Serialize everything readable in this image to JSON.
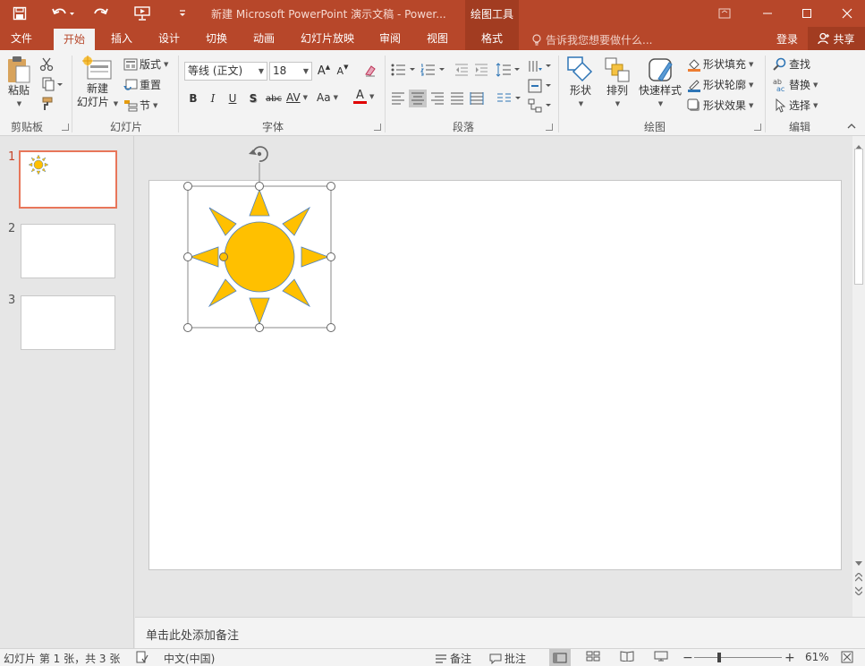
{
  "window": {
    "title": "新建 Microsoft PowerPoint 演示文稿 - Power...",
    "drawing_tools": "绘图工具"
  },
  "tabs": [
    "文件",
    "开始",
    "插入",
    "设计",
    "切换",
    "动画",
    "幻灯片放映",
    "审阅",
    "视图",
    "格式"
  ],
  "active_tab": "开始",
  "tell_me": "告诉我您想要做什么...",
  "account": {
    "login": "登录",
    "share": "共享"
  },
  "ribbon": {
    "clipboard": {
      "paste": "粘贴",
      "label": "剪贴板"
    },
    "slides": {
      "new_slide_line1": "新建",
      "new_slide_line2": "幻灯片",
      "layout": "版式",
      "reset": "重置",
      "section": "节",
      "label": "幻灯片"
    },
    "font": {
      "font_name": "等线 (正文)",
      "font_size": "18",
      "bold": "B",
      "italic": "I",
      "underline": "U",
      "shadow": "S",
      "strike": "abc",
      "spacing": "AV",
      "case": "Aa",
      "color": "A",
      "label": "字体"
    },
    "paragraph": {
      "label": "段落"
    },
    "drawing": {
      "shapes": "形状",
      "arrange": "排列",
      "quick_styles": "快速样式",
      "shape_fill": "形状填充",
      "shape_outline": "形状轮廓",
      "shape_effects": "形状效果",
      "label": "绘图"
    },
    "editing": {
      "find": "查找",
      "replace": "替换",
      "select": "选择",
      "label": "编辑"
    }
  },
  "thumbnails": [
    {
      "number": "1",
      "selected": true
    },
    {
      "number": "2",
      "selected": false
    },
    {
      "number": "3",
      "selected": false
    }
  ],
  "notes_placeholder": "单击此处添加备注",
  "status": {
    "slide_info": "幻灯片 第 1 张，共 3 张",
    "language": "中文(中国)",
    "notes": "备注",
    "comments": "批注",
    "zoom": "61%"
  },
  "colors": {
    "accent": "#b7472a",
    "sun_fill": "#ffc000",
    "sun_stroke": "#4f81bd"
  }
}
